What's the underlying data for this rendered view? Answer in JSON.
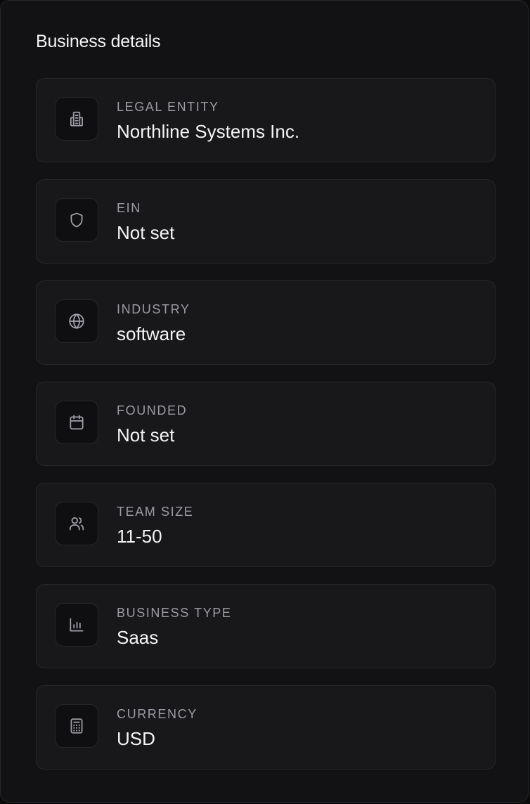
{
  "card": {
    "title": "Business details"
  },
  "details": [
    {
      "icon": "building-icon",
      "label": "LEGAL ENTITY",
      "value": "Northline Systems Inc."
    },
    {
      "icon": "shield-icon",
      "label": "EIN",
      "value": "Not set"
    },
    {
      "icon": "globe-icon",
      "label": "INDUSTRY",
      "value": "software"
    },
    {
      "icon": "calendar-icon",
      "label": "FOUNDED",
      "value": "Not set"
    },
    {
      "icon": "users-icon",
      "label": "TEAM SIZE",
      "value": "11-50"
    },
    {
      "icon": "bar-chart-icon",
      "label": "BUSINESS TYPE",
      "value": "Saas"
    },
    {
      "icon": "calculator-icon",
      "label": "CURRENCY",
      "value": "USD"
    }
  ]
}
